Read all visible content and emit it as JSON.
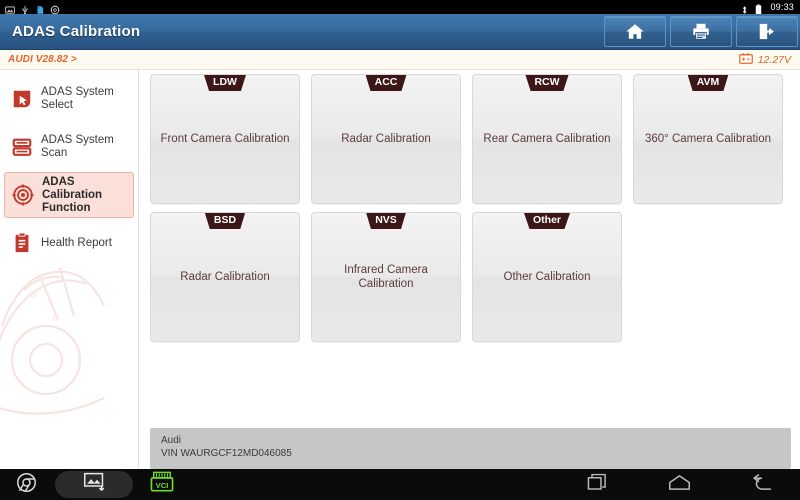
{
  "statusbar": {
    "icons": [
      "screenshot-icon",
      "usb-icon",
      "sdcard-icon",
      "settings-icon",
      "bluetooth-icon",
      "battery-icon"
    ],
    "time": "09:33"
  },
  "header": {
    "title": "ADAS Calibration",
    "buttons": [
      {
        "name": "home-button",
        "icon": "home-icon"
      },
      {
        "name": "print-button",
        "icon": "printer-icon"
      },
      {
        "name": "exit-button",
        "icon": "exit-icon"
      }
    ]
  },
  "versionbar": {
    "vehicle_version": "AUDI V28.82 >",
    "voltage": "12.27V",
    "accent_color": "#e8622a"
  },
  "sidebar": {
    "items": [
      {
        "label": "ADAS System Select",
        "icon": "cursor-select-icon",
        "active": false
      },
      {
        "label": "ADAS System Scan",
        "icon": "scan-list-icon",
        "active": false
      },
      {
        "label": "ADAS Calibration Function",
        "icon": "target-icon",
        "active": true
      },
      {
        "label": "Health Report",
        "icon": "clipboard-report-icon",
        "active": false
      }
    ],
    "collapse_button": {
      "name": "sidebar-collapse-button",
      "icon": "skip-back-icon"
    },
    "active_color": "#fbdfd9"
  },
  "main": {
    "cards": [
      {
        "tag": "LDW",
        "label": "Front Camera Calibration"
      },
      {
        "tag": "ACC",
        "label": "Radar Calibration"
      },
      {
        "tag": "RCW",
        "label": "Rear Camera Calibration"
      },
      {
        "tag": "AVM",
        "label": "360° Camera Calibration"
      },
      {
        "tag": "BSD",
        "label": "Radar Calibration"
      },
      {
        "tag": "NVS",
        "label": "Infrared Camera Calibration"
      },
      {
        "tag": "Other",
        "label": "Other Calibration"
      }
    ],
    "tag_color": "#3d1718",
    "label_color": "#5c3b3b"
  },
  "vehicle_info": {
    "make": "Audi",
    "vin": "VIN WAURGCF12MD046085"
  },
  "navbar": {
    "left_buttons": [
      {
        "name": "browser-button",
        "icon": "browser-icon"
      },
      {
        "name": "screenshot-button",
        "icon": "screenshot-capture-icon"
      },
      {
        "name": "vci-button",
        "icon": "vci-connector-icon",
        "label": "VCI"
      }
    ],
    "system_buttons": [
      {
        "name": "recent-apps-button",
        "icon": "recent-apps-icon"
      },
      {
        "name": "home-nav-button",
        "icon": "home-nav-icon"
      },
      {
        "name": "back-nav-button",
        "icon": "back-arrow-icon"
      }
    ]
  }
}
